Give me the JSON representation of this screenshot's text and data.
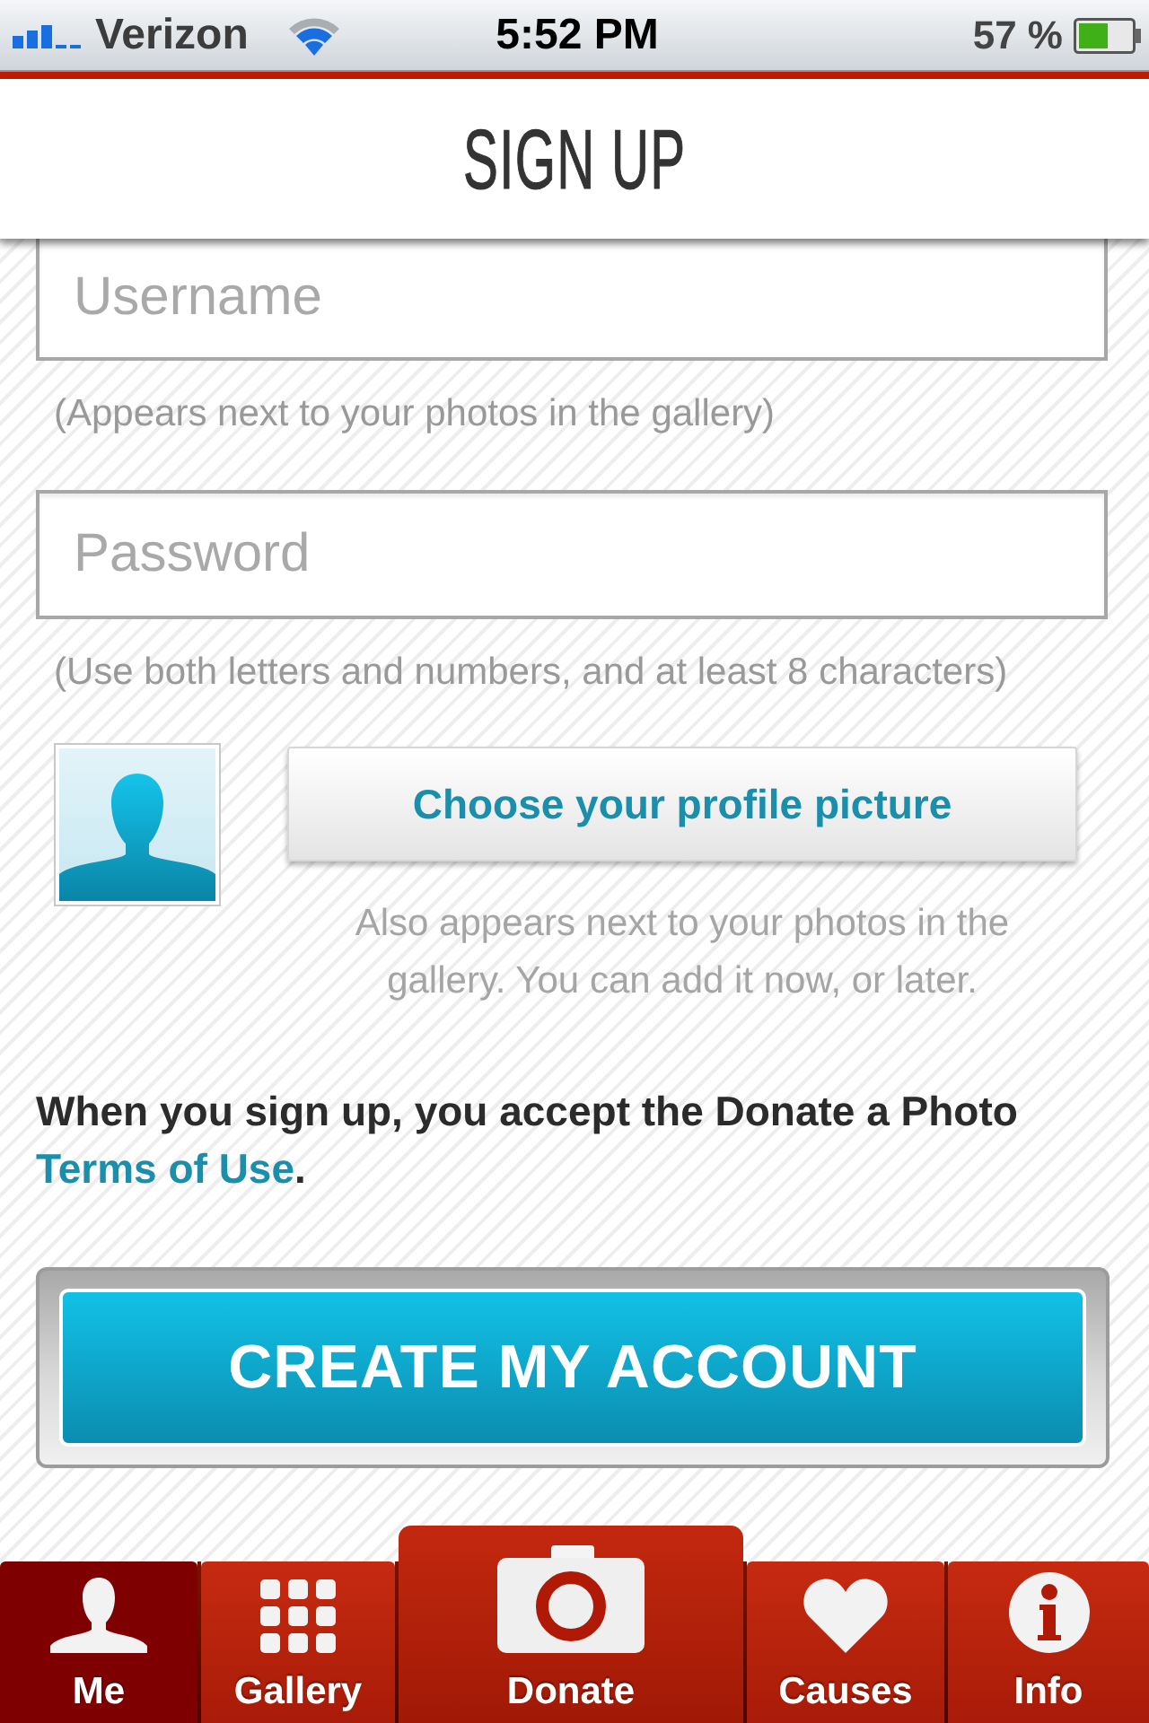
{
  "status_bar": {
    "carrier": "Verizon",
    "time": "5:52 PM",
    "battery": "57 %"
  },
  "header": {
    "title": "SIGN UP"
  },
  "fields": [
    {
      "placeholder": "Username",
      "hint": "(Appears next to your photos in the gallery)"
    },
    {
      "placeholder": "Password",
      "hint": "(Use both letters and numbers, and at least 8 characters)"
    }
  ],
  "profile_picture": {
    "button": "Choose your profile picture",
    "note": "Also appears next to your photos in the gallery. You can add it now, or later."
  },
  "terms": {
    "text": "When you sign up, you accept the Donate a Photo",
    "link": "Terms of Use",
    "end": "."
  },
  "submit_button": "CREATE MY ACCOUNT",
  "tab_bar": [
    {
      "label": "Me",
      "kind": "standard",
      "selected": true
    },
    {
      "label": "Gallery",
      "kind": "standard",
      "selected": false
    },
    {
      "label": "Donate",
      "kind": "featured",
      "selected": false
    },
    {
      "label": "Causes",
      "kind": "standard",
      "selected": false
    },
    {
      "label": "Info",
      "kind": "standard",
      "selected": false
    }
  ]
}
